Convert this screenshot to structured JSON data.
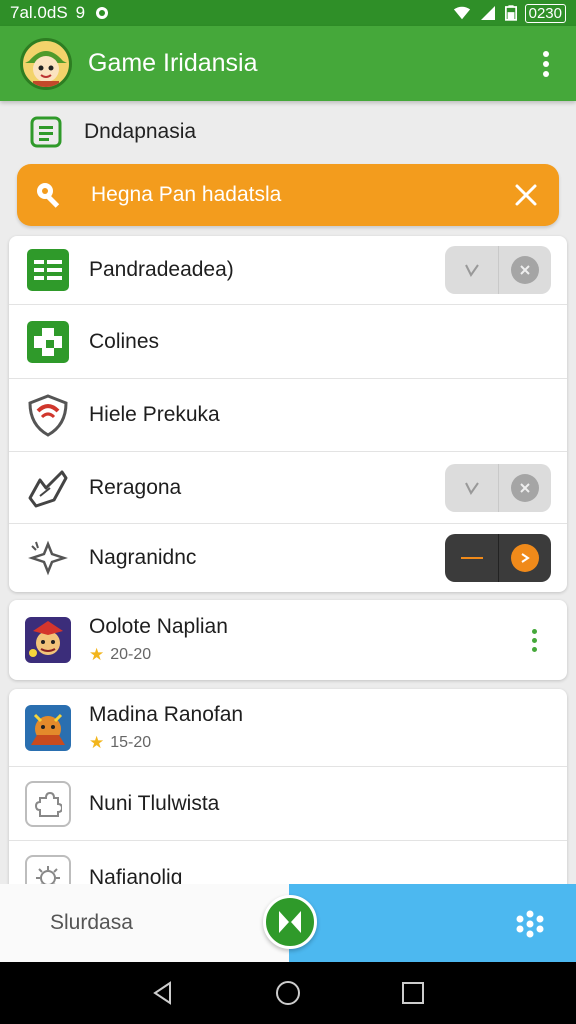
{
  "status_bar": {
    "left_text": "7al.0dS",
    "left_number": "9",
    "time": "0230"
  },
  "app_bar": {
    "title": "Game Iridansia",
    "logo_icon": "mascot-logo",
    "menu_icon": "more-vert-icon"
  },
  "section": {
    "title": "Dndapnasia",
    "icon": "list-icon"
  },
  "search": {
    "text": "Hegna Pan hadatsla",
    "icon": "key-icon",
    "clear_icon": "close-icon",
    "color": "#f39c1d"
  },
  "settings": {
    "items": [
      {
        "label": "Pandradeadea)",
        "icon": "grid-green-icon",
        "has_toggle": true,
        "toggle_on": false
      },
      {
        "label": "Colines",
        "icon": "plus-square-icon",
        "has_toggle": false
      },
      {
        "label": "Hiele Prekuka",
        "icon": "shield-icon",
        "has_toggle": false
      },
      {
        "label": "Reragona",
        "icon": "hand-icon",
        "has_toggle": true,
        "toggle_on": false
      },
      {
        "label": "Nagranidnc",
        "icon": "sparkle-icon",
        "has_toggle": true,
        "toggle_on": true
      }
    ]
  },
  "games": [
    {
      "name": "Oolote Naplian",
      "rating": "20-20",
      "icon": "game-thumb-1"
    },
    {
      "name": "Madina Ranofan",
      "rating": "15-20",
      "icon": "game-thumb-2"
    },
    {
      "name": "Nuni Tlulwista",
      "icon": "puzzle-icon"
    },
    {
      "name": "Nafianolig",
      "icon": "gear-icon"
    }
  ],
  "bottom_bar": {
    "left_label": "Slurdasa",
    "fab_icon": "x-action-icon",
    "right_icon": "dots-grid-icon",
    "accent": "#4cb8f0"
  },
  "colors": {
    "primary": "#45a83a",
    "status_bar": "#2f8f28",
    "accent_orange": "#f39c1d"
  }
}
